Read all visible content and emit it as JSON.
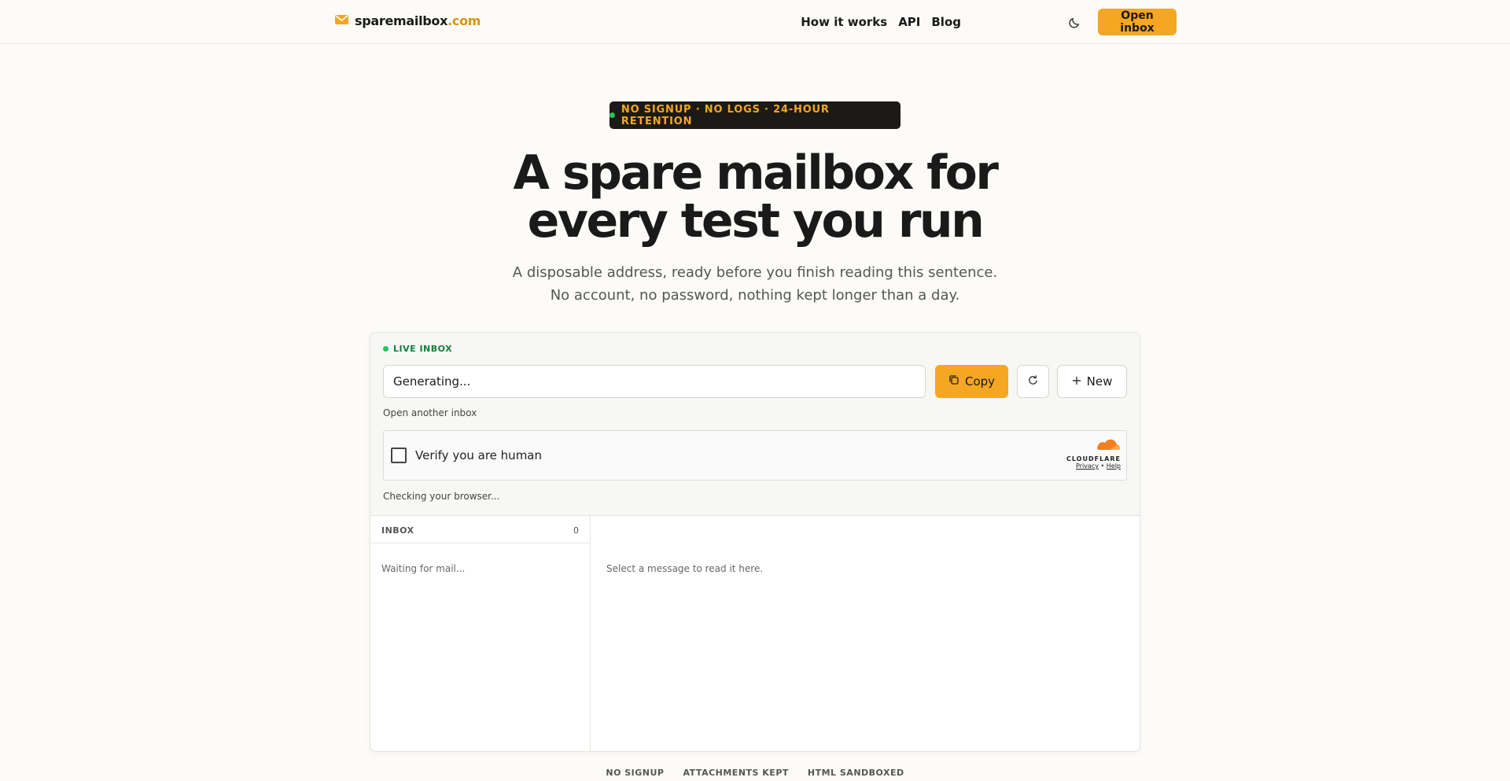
{
  "header": {
    "brand_name": "sparemailbox",
    "brand_tld": ".com",
    "nav": [
      "How it works",
      "API",
      "Blog"
    ],
    "theme_icon": "moon-icon",
    "open_inbox_label": "Open inbox",
    "accent": "#f5a623"
  },
  "hero": {
    "badge": "NO SIGNUP · NO LOGS · 24-HOUR RETENTION",
    "title_line1": "A spare mailbox for",
    "title_line2": "every test you run",
    "subtitle": "A disposable address, ready before you finish reading this sentence. No account, no password, nothing kept longer than a day."
  },
  "inbox_card": {
    "live_label": "LIVE INBOX",
    "address_value": "Generating...",
    "copy_label": "Copy",
    "new_label": "New",
    "open_another": "Open another inbox",
    "captcha": {
      "label": "Verify you are human",
      "brand": "CLOUDFLARE",
      "privacy": "Privacy",
      "separator": "•",
      "help": "Help"
    },
    "checking": "Checking your browser...",
    "list_title": "INBOX",
    "list_count": "0",
    "waiting": "Waiting for mail...",
    "reader_empty": "Select a message to read it here."
  },
  "features": [
    "NO SIGNUP",
    "ATTACHMENTS KEPT",
    "HTML SANDBOXED"
  ]
}
